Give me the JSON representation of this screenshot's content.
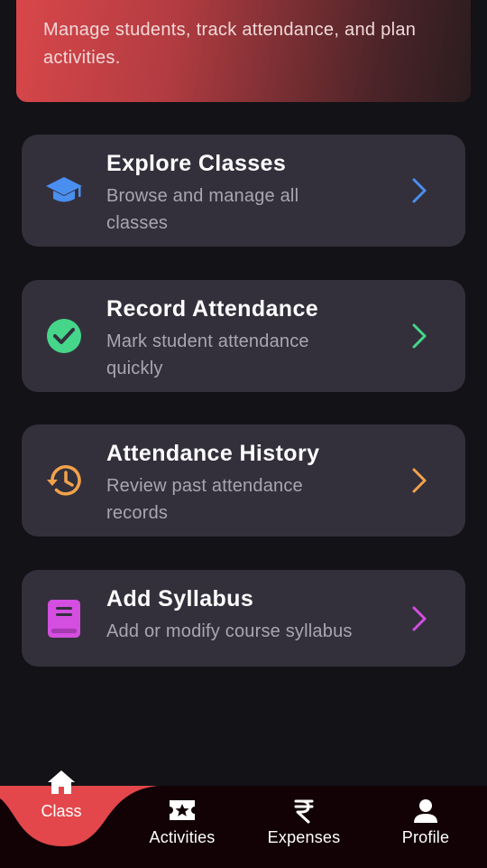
{
  "header": {
    "description": "Manage students, track attendance, and plan activities."
  },
  "cards": [
    {
      "title": "Explore Classes",
      "subtitle": "Browse and manage all classes",
      "icon": "graduation-cap-icon",
      "color": "#4a8ff0"
    },
    {
      "title": "Record Attendance",
      "subtitle": "Mark student attendance quickly",
      "icon": "check-circle-icon",
      "color": "#45d68a"
    },
    {
      "title": "Attendance History",
      "subtitle": "Review past attendance records",
      "icon": "history-icon",
      "color": "#f2a24a"
    },
    {
      "title": "Add Syllabus",
      "subtitle": "Add or modify course syllabus",
      "icon": "book-icon",
      "color": "#d44ee0"
    }
  ],
  "nav": {
    "items": [
      {
        "label": "Class",
        "icon": "home-icon",
        "active": true
      },
      {
        "label": "Activities",
        "icon": "star-ticket-icon"
      },
      {
        "label": "Expenses",
        "icon": "rupee-icon"
      },
      {
        "label": "Profile",
        "icon": "person-icon"
      }
    ],
    "active_color": "#e3474b"
  }
}
